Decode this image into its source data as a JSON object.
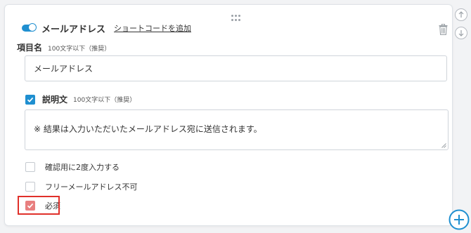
{
  "field": {
    "title": "メールアドレス",
    "shortcode_link": "ショートコードを追加",
    "enabled": true
  },
  "item_name": {
    "label": "項目名",
    "hint": "100文字以下（推奨）",
    "value": "メールアドレス"
  },
  "description": {
    "label": "説明文",
    "hint": "100文字以下（推奨）",
    "checked": true,
    "value": "※ 結果は入力いただいたメールアドレス宛に送信されます。"
  },
  "options": [
    {
      "label": "確認用に2度入力する",
      "checked": false
    },
    {
      "label": "フリーメールアドレス不可",
      "checked": false
    },
    {
      "label": "必須",
      "checked": true
    }
  ],
  "colors": {
    "accent": "#1f8fd0",
    "required_check": "#e87f7f",
    "highlight": "#e0302a"
  },
  "icons": {
    "drag": "drag-handle-icon",
    "trash": "trash-icon",
    "move_up": "arrow-up-icon",
    "move_down": "arrow-down-icon",
    "add": "plus-circle-icon"
  }
}
